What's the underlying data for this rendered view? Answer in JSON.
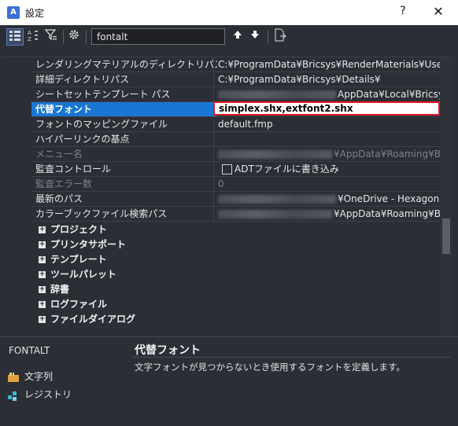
{
  "window": {
    "title": "設定",
    "help": "?",
    "close": "✕"
  },
  "search": {
    "value": "fontalt"
  },
  "rows": [
    {
      "name": "レンダリングマテリアルのディレクトリパス",
      "value": "C:¥ProgramData¥Bricsys¥RenderMaterials¥UserMaterials"
    },
    {
      "name": "詳細ディレクトリパス",
      "value": "C:¥ProgramData¥Bricsys¥Details¥"
    },
    {
      "name": "シートセットテンプレート パス",
      "value": "AppData¥Local¥Bricsys¥"
    },
    {
      "name": "代替フォント",
      "value": "simplex.shx,extfont2.shx"
    },
    {
      "name": "フォントのマッピングファイル",
      "value": "default.fmp"
    },
    {
      "name": "ハイパーリンクの基点",
      "value": ""
    },
    {
      "name": "メニュー名",
      "value": "¥AppData¥Roaming¥Bric"
    },
    {
      "name": "監査コントロール",
      "value": "ADTファイルに書き込み"
    },
    {
      "name": "監査エラー数",
      "value": "0"
    },
    {
      "name": "最新のパス",
      "value": "¥OneDrive - Hexagon¥ド"
    },
    {
      "name": "カラーブックファイル検索パス",
      "value": "¥AppData¥Roaming¥Bric"
    }
  ],
  "categories": [
    "プロジェクト",
    "プリンタサポート",
    "テンプレート",
    "ツールパレット",
    "辞書",
    "ログファイル",
    "ファイルダイアログ"
  ],
  "info": {
    "variable": "FONTALT",
    "type_label": "文字列",
    "storage_label": "レジストリ",
    "title": "代替フォント",
    "description": "文字フォントが見つからないとき使用するフォントを定義します。"
  }
}
